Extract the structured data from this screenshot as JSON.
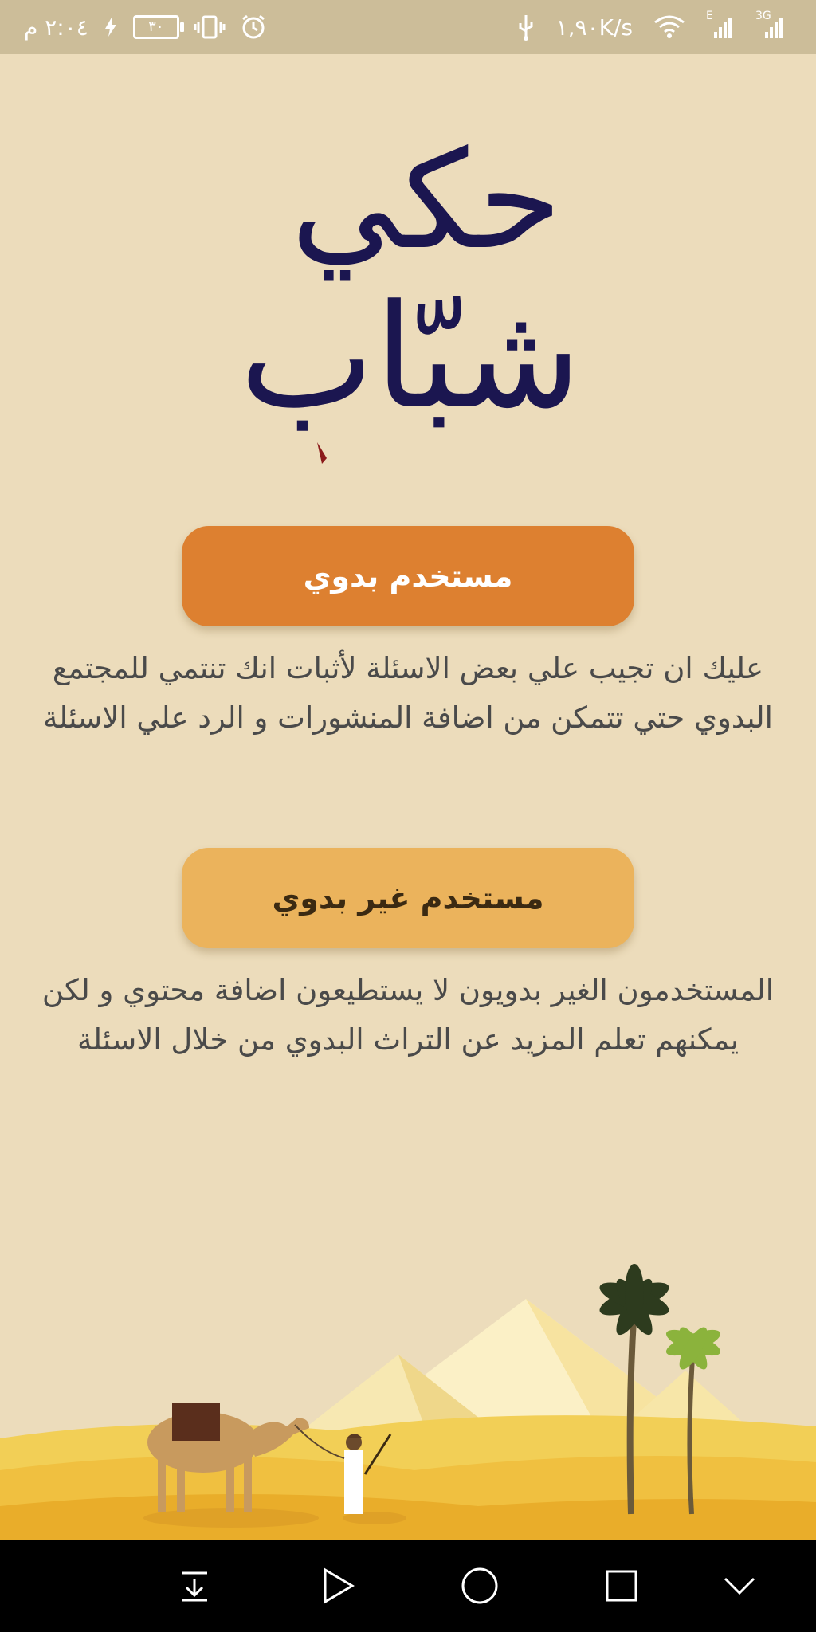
{
  "status_bar": {
    "time": "٢:٠٤ م",
    "battery": "٣٠",
    "network_speed": "١,٩٠K/s",
    "signal_label_1": "E",
    "signal_label_2": "3G"
  },
  "logo": {
    "line1": "حكي",
    "line2": "شبّاب",
    "text_color": "#1b1650",
    "dot_color": "#8b1a1a"
  },
  "options": {
    "bedouin_label": "مستخدم بدوي",
    "bedouin_description": "عليك ان تجيب علي بعض الاسئلة لأثبات انك تنتمي للمجتمع البدوي حتي تتمكن من اضافة المنشورات و الرد علي الاسئلة",
    "non_bedouin_label": "مستخدم غير بدوي",
    "non_bedouin_description": "المستخدمون الغير بدويون لا يستطيعون اضافة محتوي و لكن يمكنهم تعلم المزيد عن التراث البدوي من خلال الاسئلة"
  },
  "colors": {
    "background": "#ecdcbb",
    "primary_button": "#dd8030",
    "secondary_button": "#ebb35c",
    "status_bar": "#ccbd99"
  },
  "nav_icons": [
    "collapse-down-icon",
    "play-icon",
    "home-circle-icon",
    "recents-square-icon",
    "chevron-down-icon"
  ]
}
